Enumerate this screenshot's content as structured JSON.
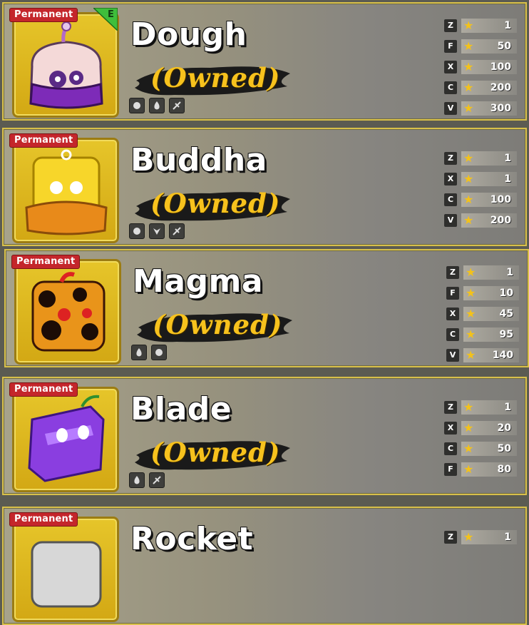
{
  "colors": {
    "badge": "#c4262b",
    "owned": "#f7c21d",
    "frame": "#e6c52a",
    "border": "#d8c04a",
    "star": "#f3c21a"
  },
  "fruits": [
    {
      "name": "Dough",
      "badge": "Permanent",
      "tier": "E",
      "owned": "(Owned)",
      "icons": [
        "spike-ball-icon",
        "flame-icon",
        "drill-icon"
      ],
      "moves": [
        {
          "key": "Z",
          "level": "1"
        },
        {
          "key": "F",
          "level": "50"
        },
        {
          "key": "X",
          "level": "100"
        },
        {
          "key": "C",
          "level": "200"
        },
        {
          "key": "V",
          "level": "300"
        }
      ]
    },
    {
      "name": "Buddha",
      "badge": "Permanent",
      "owned": "(Owned)",
      "icons": [
        "spike-ball-icon",
        "beast-icon",
        "drill-icon"
      ],
      "moves": [
        {
          "key": "Z",
          "level": "1"
        },
        {
          "key": "X",
          "level": "1"
        },
        {
          "key": "C",
          "level": "100"
        },
        {
          "key": "V",
          "level": "200"
        }
      ]
    },
    {
      "name": "Magma",
      "badge": "Permanent",
      "owned": "(Owned)",
      "icons": [
        "flame-icon",
        "spike-ball-icon"
      ],
      "moves": [
        {
          "key": "Z",
          "level": "1"
        },
        {
          "key": "F",
          "level": "10"
        },
        {
          "key": "X",
          "level": "45"
        },
        {
          "key": "C",
          "level": "95"
        },
        {
          "key": "V",
          "level": "140"
        }
      ]
    },
    {
      "name": "Blade",
      "badge": "Permanent",
      "owned": "(Owned)",
      "icons": [
        "flame-icon",
        "drill-icon"
      ],
      "moves": [
        {
          "key": "Z",
          "level": "1"
        },
        {
          "key": "X",
          "level": "20"
        },
        {
          "key": "C",
          "level": "50"
        },
        {
          "key": "F",
          "level": "80"
        }
      ]
    },
    {
      "name": "Rocket",
      "badge": "Permanent",
      "owned": "",
      "icons": [],
      "moves": [
        {
          "key": "Z",
          "level": "1"
        }
      ]
    }
  ]
}
